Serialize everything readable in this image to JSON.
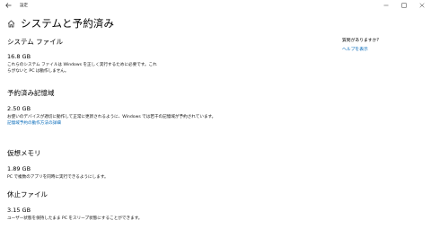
{
  "window": {
    "app_title": "設定"
  },
  "header": {
    "title": "システムと予約済み"
  },
  "sections": [
    {
      "title": "システム ファイル",
      "size": "16.8 GB",
      "desc_lines": [
        "これらのシステム ファイルは Windows を正しく実行するために必要です。これ",
        "らがないと PC は動作しません。"
      ]
    },
    {
      "title": "予約済み記憶域",
      "size": "2.50 GB",
      "desc_lines": [
        "お使いのデバイスが適切に動作して正常に更新されるように、Windows では若干の記憶域が予約されています。"
      ],
      "link": "記憶域予約の動作方法の詳細"
    },
    {
      "title": "仮想メモリ",
      "size": "1.89 GB",
      "desc_lines": [
        "PC で複数のアプリを同時に実行できるようにします。"
      ]
    },
    {
      "title": "休止ファイル",
      "size": "3.15 GB",
      "desc_lines": [
        "ユーザー状態を保持したまま PC をスリープ状態にすることができます。"
      ]
    }
  ],
  "sidebar": {
    "question": "質問がありますか?",
    "help_link": "ヘルプを表示"
  }
}
